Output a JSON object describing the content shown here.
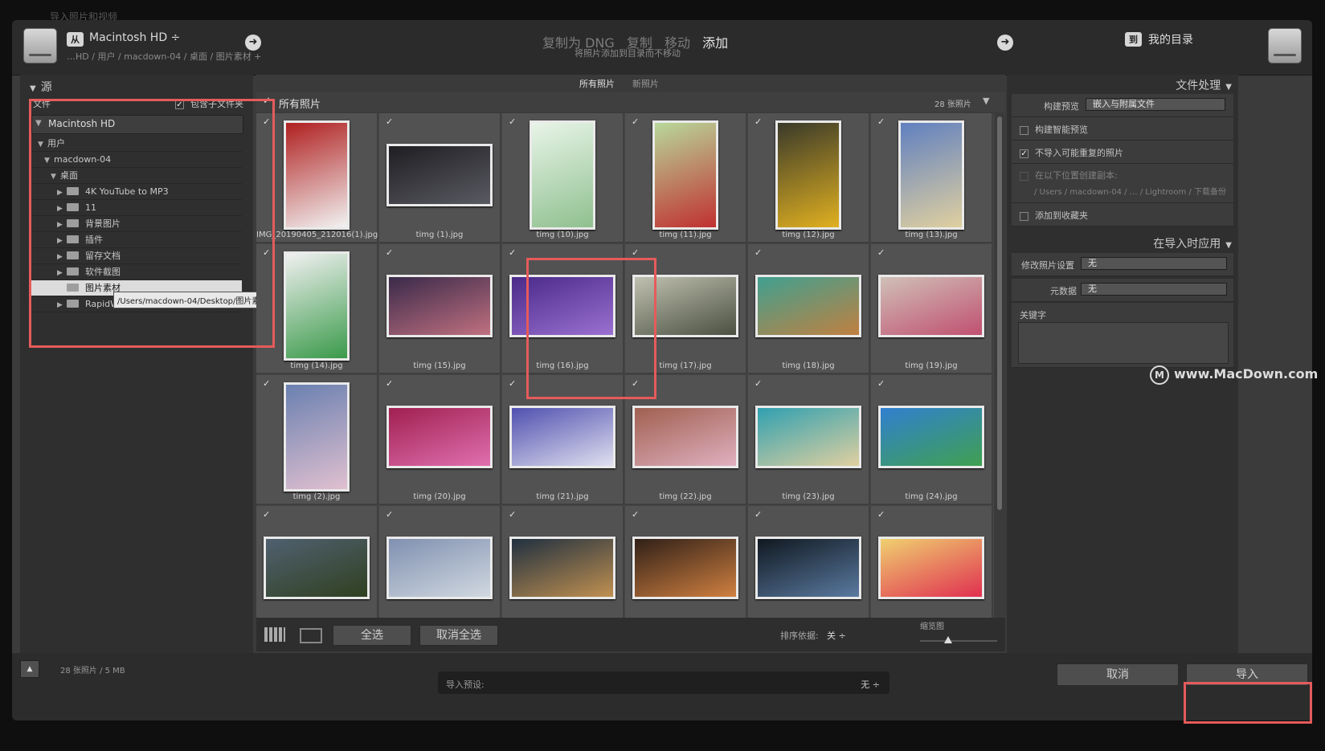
{
  "behind": {
    "title": "导入照片和视频"
  },
  "header": {
    "from_chip": "从",
    "source_disk": "Macintosh HD ÷",
    "source_path": "…HD / 用户 / macdown-04 / 桌面 / 图片素材 +",
    "modes": [
      "复制为 DNG",
      "复制",
      "移动",
      "添加"
    ],
    "mode_subtitle": "将照片添加到目录而不移动",
    "to_chip": "到",
    "dest_label": "我的目录"
  },
  "source_panel": {
    "title": "源",
    "files_label": "文件",
    "include_subfolders": "包含子文件夹",
    "disk": "Macintosh HD",
    "tree": [
      {
        "label": "用户",
        "level": 1,
        "expanded": true
      },
      {
        "label": "macdown-04",
        "level": 2,
        "expanded": true
      },
      {
        "label": "桌面",
        "level": 3,
        "expanded": true
      },
      {
        "label": "4K YouTube to MP3",
        "level": 4,
        "folder": true
      },
      {
        "label": "11",
        "level": 4,
        "folder": true
      },
      {
        "label": "背景图片",
        "level": 4,
        "folder": true
      },
      {
        "label": "插件",
        "level": 4,
        "folder": true
      },
      {
        "label": "留存文档",
        "level": 4,
        "folder": true
      },
      {
        "label": "软件截图",
        "level": 4,
        "folder": true
      },
      {
        "label": "图片素材",
        "level": 4,
        "folder": true,
        "selected": true
      },
      {
        "label": "RapidW",
        "level": 4,
        "folder": true
      }
    ],
    "tooltip": "/Users/macdown-04/Desktop/图片素材"
  },
  "grid": {
    "tabs": [
      "所有照片",
      "新照片"
    ],
    "title": "所有照片",
    "count": "28 张照片",
    "photos": [
      {
        "name": "IMG_20190405_212016(1).jpg",
        "colors": [
          "#b02020",
          "#f2f2f2"
        ],
        "orient": "portrait"
      },
      {
        "name": "timg (1).jpg",
        "colors": [
          "#1e1e22",
          "#5a5a62"
        ],
        "orient": "landscape"
      },
      {
        "name": "timg (10).jpg",
        "colors": [
          "#e8f4e8",
          "#8fc08f"
        ],
        "orient": "portrait"
      },
      {
        "name": "timg (11).jpg",
        "colors": [
          "#b8d89a",
          "#c03030"
        ],
        "orient": "portrait"
      },
      {
        "name": "timg (12).jpg",
        "colors": [
          "#3a3a2a",
          "#e0b020"
        ],
        "orient": "portrait"
      },
      {
        "name": "timg (13).jpg",
        "colors": [
          "#6080c0",
          "#e0d0a0"
        ],
        "orient": "portrait"
      },
      {
        "name": "timg (14).jpg",
        "colors": [
          "#f0f0f0",
          "#3a9a4a"
        ],
        "orient": "portrait"
      },
      {
        "name": "timg (15).jpg",
        "colors": [
          "#3a2a4a",
          "#c07080"
        ],
        "orient": "landscape"
      },
      {
        "name": "timg (16).jpg",
        "colors": [
          "#4a2a8a",
          "#9a70d0"
        ],
        "orient": "landscape"
      },
      {
        "name": "timg (17).jpg",
        "colors": [
          "#c0c0b0",
          "#4a5040"
        ],
        "orient": "landscape"
      },
      {
        "name": "timg (18).jpg",
        "colors": [
          "#40a090",
          "#c08040"
        ],
        "orient": "landscape"
      },
      {
        "name": "timg (19).jpg",
        "colors": [
          "#d0c0b8",
          "#c05070"
        ],
        "orient": "landscape"
      },
      {
        "name": "timg (2).jpg",
        "colors": [
          "#6a80b0",
          "#e0c0d0"
        ],
        "orient": "portrait"
      },
      {
        "name": "timg (20).jpg",
        "colors": [
          "#a02050",
          "#e070b0"
        ],
        "orient": "landscape"
      },
      {
        "name": "timg (21).jpg",
        "colors": [
          "#5050b0",
          "#e0e0f0"
        ],
        "orient": "landscape"
      },
      {
        "name": "timg (22).jpg",
        "colors": [
          "#a06050",
          "#e0b0c0"
        ],
        "orient": "landscape"
      },
      {
        "name": "timg (23).jpg",
        "colors": [
          "#30a0b0",
          "#e0d0a0"
        ],
        "orient": "landscape"
      },
      {
        "name": "timg (24).jpg",
        "colors": [
          "#3080d0",
          "#40a050"
        ],
        "orient": "landscape"
      },
      {
        "name": "",
        "colors": [
          "#506070",
          "#304020"
        ],
        "orient": "landscape"
      },
      {
        "name": "",
        "colors": [
          "#8090b0",
          "#d0d8e0"
        ],
        "orient": "landscape"
      },
      {
        "name": "",
        "colors": [
          "#203040",
          "#c09050"
        ],
        "orient": "landscape"
      },
      {
        "name": "",
        "colors": [
          "#302018",
          "#d08040"
        ],
        "orient": "landscape"
      },
      {
        "name": "",
        "colors": [
          "#101820",
          "#5a7aa0"
        ],
        "orient": "landscape"
      },
      {
        "name": "",
        "colors": [
          "#f0d070",
          "#e03050"
        ],
        "orient": "landscape"
      }
    ]
  },
  "toolbar": {
    "select_all": "全选",
    "deselect_all": "取消全选",
    "sort_label": "排序依据:",
    "sort_value": "关 ÷",
    "thumb_label": "缩览图"
  },
  "file_handling": {
    "title": "文件处理",
    "build_preview_label": "构建预览",
    "build_preview_value": "嵌入与附属文件",
    "smart_preview": "构建智能预览",
    "no_duplicates": "不导入可能重复的照片",
    "make_copy": "在以下位置创建副本:",
    "copy_path": "/ Users / macdown-04 / … / Lightroom / 下载备份",
    "add_collection": "添加到收藏夹"
  },
  "apply_during_import": {
    "title": "在导入时应用",
    "develop_label": "修改照片设置",
    "develop_value": "无",
    "metadata_label": "元数据",
    "metadata_value": "无",
    "keywords_label": "关键字"
  },
  "watermark": "www.MacDown.com",
  "footer": {
    "summary": "28 张照片 / 5 MB",
    "preset_label": "导入预设:",
    "preset_value": "无 ÷",
    "cancel": "取消",
    "import": "导入"
  }
}
